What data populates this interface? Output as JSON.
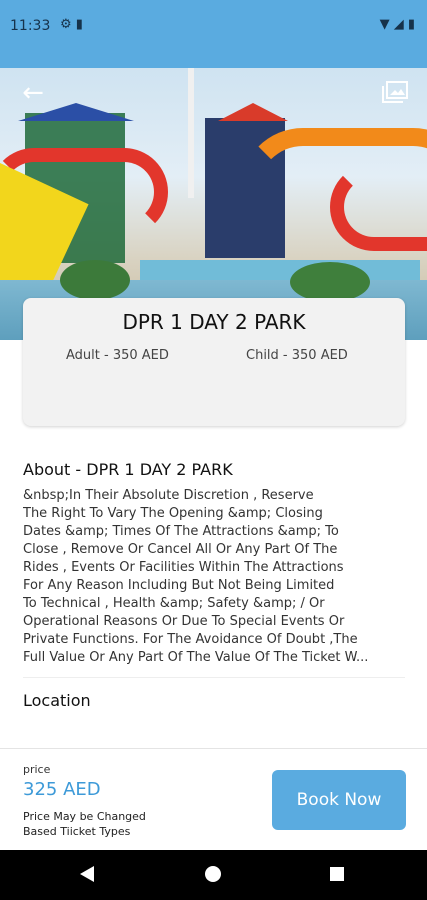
{
  "status_bar": {
    "time": "11:33",
    "left_icons": [
      "gear-icon",
      "sd-card-icon"
    ],
    "right_icons": [
      "wifi-icon",
      "signal-icon",
      "battery-icon"
    ]
  },
  "hero": {
    "back_icon": "back-arrow-icon",
    "gallery_icon": "gallery-icon"
  },
  "ticket": {
    "title": "DPR 1 DAY 2 PARK",
    "adult": "Adult  - 350 AED",
    "child": "Child  - 350 AED"
  },
  "about": {
    "title": "About - DPR 1 DAY 2 PARK",
    "lines": [
      "&nbsp;In Their Absolute Discretion , Reserve",
      "The Right To Vary The Opening &amp; Closing",
      "Dates &amp; Times Of The Attractions &amp; To",
      "Close , Remove Or Cancel All Or Any Part Of The",
      "Rides , Events Or Facilities Within The Attractions",
      "For Any Reason Including But Not Being Limited",
      "To Technical , Health &amp; Safety &amp; / Or",
      "Operational Reasons Or Due To Special Events Or",
      "Private Functions. For The Avoidance Of Doubt ,The",
      "Full Value Or Any Part Of The Value Of The Ticket W..."
    ]
  },
  "location": {
    "title": "Location"
  },
  "price_bar": {
    "label": "price",
    "value": "325 AED",
    "note": "Price May be Changed Based Tiicket Types",
    "book_label": "Book Now"
  },
  "colors": {
    "accent": "#5aabe0",
    "price_text": "#3d9ad8"
  }
}
